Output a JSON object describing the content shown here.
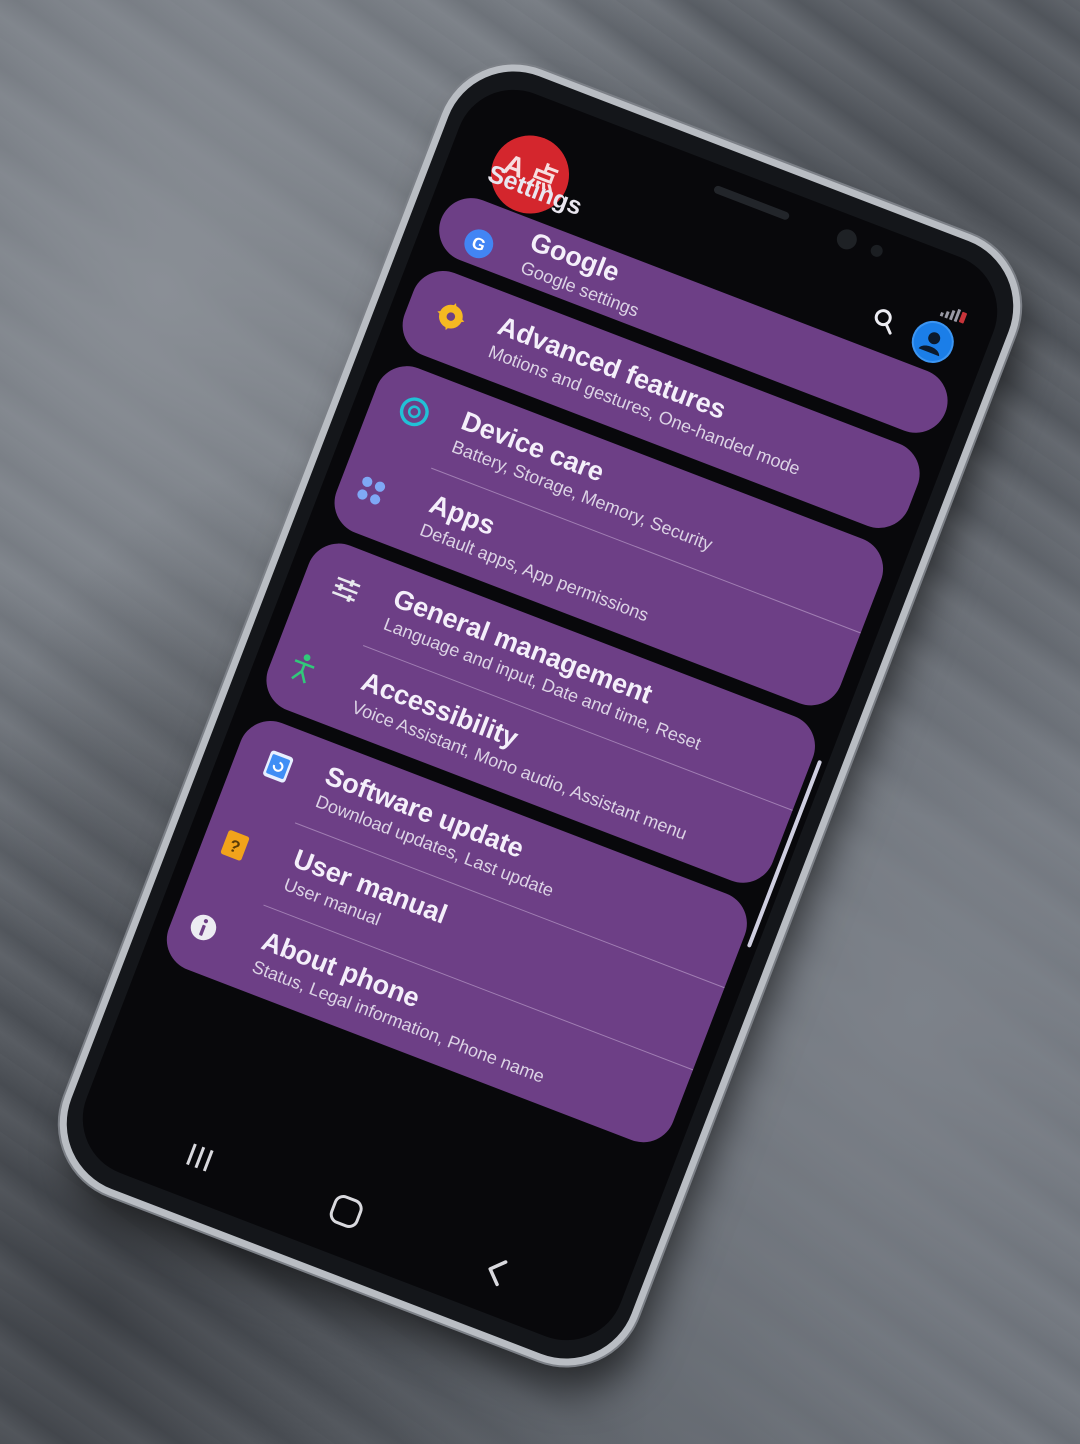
{
  "app": {
    "title": "Settings",
    "avatar_text": "A 点"
  },
  "header": {
    "search_icon": "search-icon",
    "profile_icon": "profile-icon",
    "signal_icon": "signal-icon"
  },
  "items": [
    {
      "title": "Google",
      "subtitle": "Google settings",
      "icon": "google-icon",
      "color": "#4285f4"
    },
    {
      "title": "Advanced features",
      "subtitle": "Motions and gestures, One-handed mode",
      "icon": "gear-plus-icon",
      "color": "#f5b921"
    },
    {
      "title": "Device care",
      "subtitle": "Battery, Storage, Memory, Security",
      "icon": "device-care-icon",
      "color": "#21c1d6"
    },
    {
      "title": "Apps",
      "subtitle": "Default apps, App permissions",
      "icon": "apps-icon",
      "color": "#5a8ff0"
    },
    {
      "title": "General management",
      "subtitle": "Language and input, Date and time, Reset",
      "icon": "sliders-icon",
      "color": "#e8e8ee"
    },
    {
      "title": "Accessibility",
      "subtitle": "Voice Assistant, Mono audio, Assistant menu",
      "icon": "accessibility-icon",
      "color": "#31c97a"
    },
    {
      "title": "Software update",
      "subtitle": "Download updates, Last update",
      "icon": "software-update-icon",
      "color": "#3f8ef5"
    },
    {
      "title": "User manual",
      "subtitle": "User manual",
      "icon": "user-manual-icon",
      "color": "#f2a31b"
    },
    {
      "title": "About phone",
      "subtitle": "Status, Legal information, Phone name",
      "icon": "info-icon",
      "color": "#b9b9c2"
    }
  ],
  "navbar": {
    "recent_icon": "recent-apps-icon",
    "home_icon": "home-icon",
    "back_icon": "back-icon"
  },
  "colors": {
    "card": "#6d3f86",
    "screen": "#08080b",
    "accent_blue": "#1b7ee8",
    "avatar_red": "#d4262d"
  }
}
